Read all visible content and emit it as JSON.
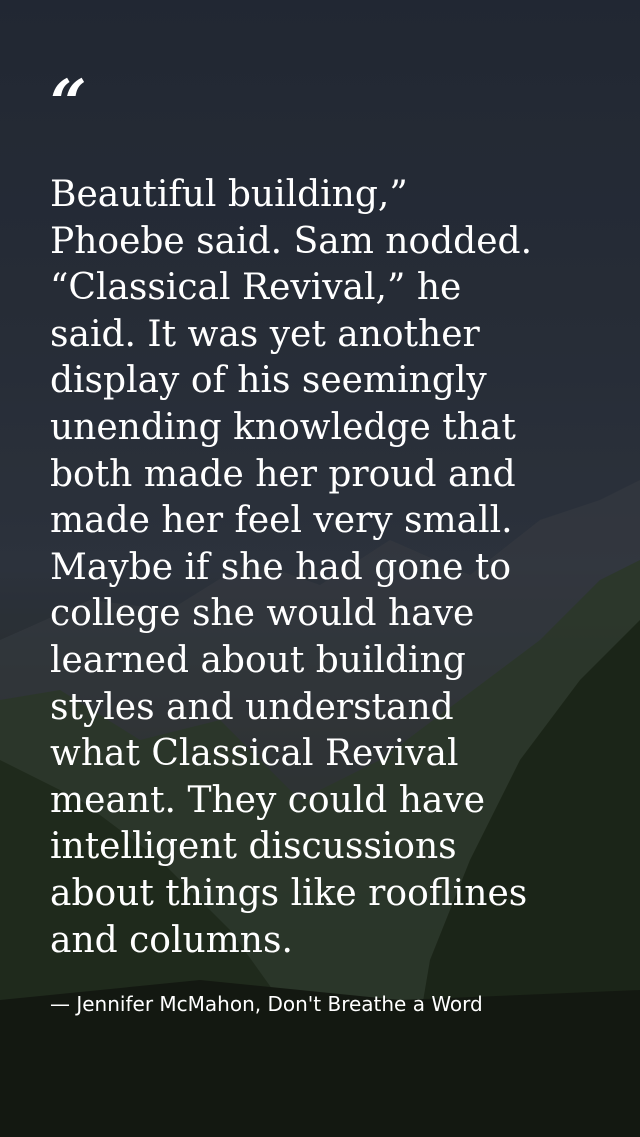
{
  "background": {
    "description_icon": "mountain-landscape-image",
    "sky_color": "#2d3544",
    "ground_color": "#1c221a"
  },
  "quote": {
    "mark": "“",
    "text": "Beautiful building,”\nPhoebe said. Sam nodded.\n“Classical Revival,” he\nsaid. It was yet another\ndisplay of his seemingly\nunending knowledge that\nboth made her proud and\nmade her feel very small.\nMaybe if she had gone to\ncollege she would have\nlearned about building\nstyles and understand\nwhat Classical Revival\nmeant. They could have\nintelligent discussions\nabout things like rooflines\nand columns.",
    "attribution": "— Jennifer McMahon, Don't Breathe a Word"
  }
}
